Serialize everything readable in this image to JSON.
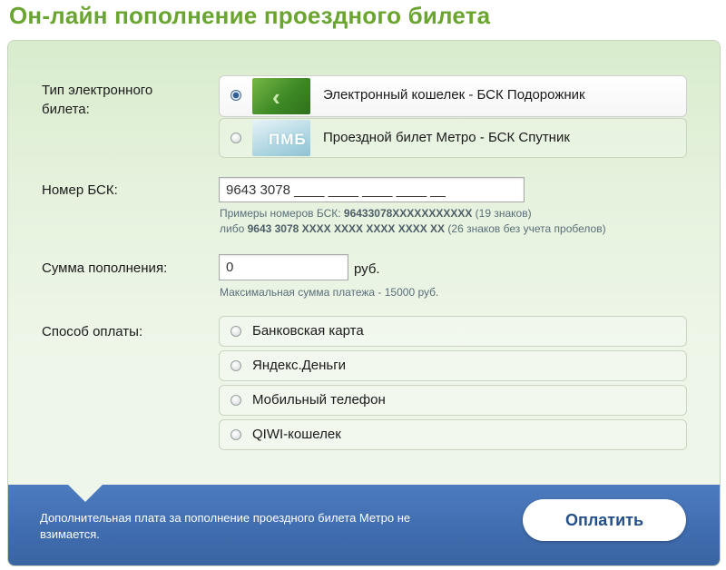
{
  "page": {
    "title": "Он-лайн пополнение проездного билета"
  },
  "ticket_type": {
    "label": "Тип электронного билета:",
    "options": [
      {
        "label": "Электронный кошелек - БСК Подорожник",
        "selected": true,
        "icon": "podorozhnik-card-icon"
      },
      {
        "label": "Проездной билет Метро - БСК Спутник",
        "selected": false,
        "icon": "sputnik-card-icon",
        "card_text": "ПМБ"
      }
    ]
  },
  "card_number": {
    "label": "Номер БСК:",
    "value": "9643 3078 ____ ____ ____ ____ __",
    "hint1_prefix": "Примеры номеров БСК: ",
    "hint1_bold": "96433078XXXXXXXXXXX",
    "hint1_suffix": " (19 знаков)",
    "hint2_prefix": "либо ",
    "hint2_bold": "9643 3078 XXXX XXXX XXXX XXXX XX",
    "hint2_suffix": " (26 знаков без учета пробелов)"
  },
  "amount": {
    "label": "Сумма пополнения:",
    "value": "0",
    "unit": "руб.",
    "hint": "Максимальная сумма платежа - 15000 руб."
  },
  "payment_method": {
    "label": "Способ оплаты:",
    "options": [
      {
        "label": "Банковская карта",
        "selected": false
      },
      {
        "label": "Яндекс.Деньги",
        "selected": false
      },
      {
        "label": "Мобильный телефон",
        "selected": false
      },
      {
        "label": "QIWI-кошелек",
        "selected": false
      }
    ]
  },
  "footer": {
    "note": "Дополнительная плата за пополнение проездного билета Метро не взимается.",
    "pay_label": "Оплатить"
  },
  "colors": {
    "title": "#6aa530",
    "footer_bg": "#4a78bb",
    "pay_text": "#244f8a"
  }
}
